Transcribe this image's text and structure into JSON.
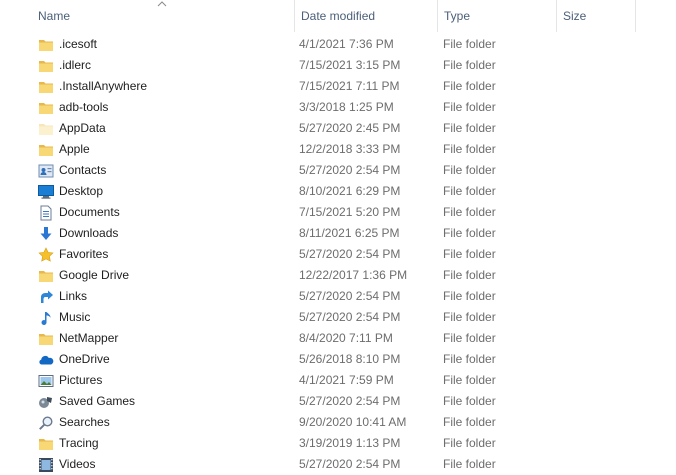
{
  "columns": {
    "name": "Name",
    "date_modified": "Date modified",
    "type": "Type",
    "size": "Size"
  },
  "sort": {
    "column": "name",
    "direction": "ascending"
  },
  "rows": [
    {
      "name": ".icesoft",
      "date": "4/1/2021 7:36 PM",
      "type": "File folder",
      "size": "",
      "icon": "folder-icon"
    },
    {
      "name": ".idlerc",
      "date": "7/15/2021 3:15 PM",
      "type": "File folder",
      "size": "",
      "icon": "folder-icon"
    },
    {
      "name": ".InstallAnywhere",
      "date": "7/15/2021 7:11 PM",
      "type": "File folder",
      "size": "",
      "icon": "folder-icon"
    },
    {
      "name": "adb-tools",
      "date": "3/3/2018 1:25 PM",
      "type": "File folder",
      "size": "",
      "icon": "folder-icon"
    },
    {
      "name": "AppData",
      "date": "5/27/2020 2:45 PM",
      "type": "File folder",
      "size": "",
      "icon": "hidden-folder-icon"
    },
    {
      "name": "Apple",
      "date": "12/2/2018 3:33 PM",
      "type": "File folder",
      "size": "",
      "icon": "folder-icon"
    },
    {
      "name": "Contacts",
      "date": "5/27/2020 2:54 PM",
      "type": "File folder",
      "size": "",
      "icon": "contacts-icon"
    },
    {
      "name": "Desktop",
      "date": "8/10/2021 6:29 PM",
      "type": "File folder",
      "size": "",
      "icon": "desktop-icon"
    },
    {
      "name": "Documents",
      "date": "7/15/2021 5:20 PM",
      "type": "File folder",
      "size": "",
      "icon": "documents-icon"
    },
    {
      "name": "Downloads",
      "date": "8/11/2021 6:25 PM",
      "type": "File folder",
      "size": "",
      "icon": "downloads-icon"
    },
    {
      "name": "Favorites",
      "date": "5/27/2020 2:54 PM",
      "type": "File folder",
      "size": "",
      "icon": "star-icon"
    },
    {
      "name": "Google Drive",
      "date": "12/22/2017 1:36 PM",
      "type": "File folder",
      "size": "",
      "icon": "folder-icon"
    },
    {
      "name": "Links",
      "date": "5/27/2020 2:54 PM",
      "type": "File folder",
      "size": "",
      "icon": "links-icon"
    },
    {
      "name": "Music",
      "date": "5/27/2020 2:54 PM",
      "type": "File folder",
      "size": "",
      "icon": "music-icon"
    },
    {
      "name": "NetMapper",
      "date": "8/4/2020 7:11 PM",
      "type": "File folder",
      "size": "",
      "icon": "folder-icon"
    },
    {
      "name": "OneDrive",
      "date": "5/26/2018 8:10 PM",
      "type": "File folder",
      "size": "",
      "icon": "onedrive-icon"
    },
    {
      "name": "Pictures",
      "date": "4/1/2021 7:59 PM",
      "type": "File folder",
      "size": "",
      "icon": "pictures-icon"
    },
    {
      "name": "Saved Games",
      "date": "5/27/2020 2:54 PM",
      "type": "File folder",
      "size": "",
      "icon": "saved-games-icon"
    },
    {
      "name": "Searches",
      "date": "9/20/2020 10:41 AM",
      "type": "File folder",
      "size": "",
      "icon": "search-icon"
    },
    {
      "name": "Tracing",
      "date": "3/19/2019 1:13 PM",
      "type": "File folder",
      "size": "",
      "icon": "folder-icon"
    },
    {
      "name": "Videos",
      "date": "5/27/2020 2:54 PM",
      "type": "File folder",
      "size": "",
      "icon": "videos-icon"
    }
  ]
}
